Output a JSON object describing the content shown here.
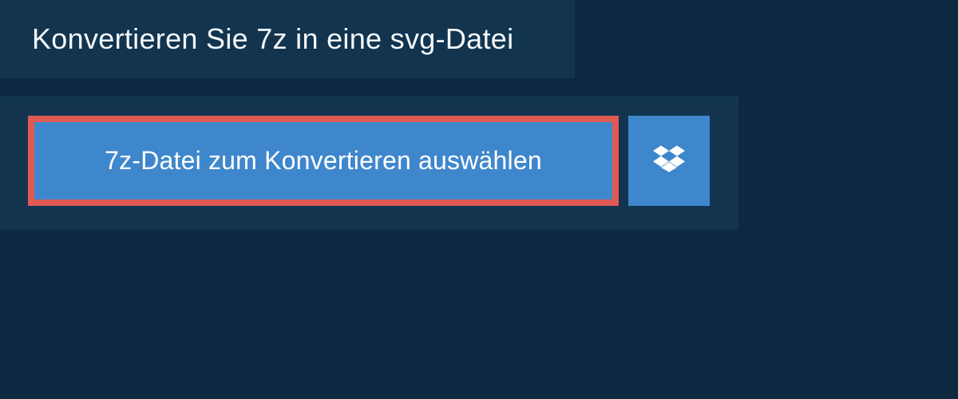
{
  "header": {
    "title": "Konvertieren Sie 7z in eine svg-Datei"
  },
  "actions": {
    "select_file_label": "7z-Datei zum Konvertieren auswählen",
    "dropbox_icon": "dropbox-icon"
  },
  "colors": {
    "background": "#0d2841",
    "panel": "#12344f",
    "button": "#3f87cc",
    "highlight_border": "#e05a54",
    "text": "#ffffff"
  }
}
